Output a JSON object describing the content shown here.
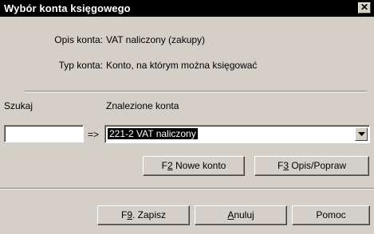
{
  "window": {
    "title": "Wybór konta księgowego",
    "close_glyph": "✕"
  },
  "info": {
    "opis_label": "Opis konta:",
    "opis_value": "VAT naliczony (zakupy)",
    "typ_label": "Typ konta:",
    "typ_value": "Konto, na którym można księgować"
  },
  "search": {
    "label": "Szukaj",
    "value": "",
    "arrow": "=>"
  },
  "found": {
    "label": "Znalezione konta",
    "selected": "221-2 VAT naliczony"
  },
  "buttons": {
    "new_account": {
      "pre": "F",
      "key": "2",
      "post": " Nowe konto"
    },
    "edit": {
      "pre": "F",
      "key": "3",
      "post": " Opis/Popraw"
    },
    "save": {
      "pre": "F",
      "key": "9",
      "post": ". Zapisz"
    },
    "cancel": {
      "pre": "",
      "key": "A",
      "post": "nuluj"
    },
    "help": {
      "pre": "",
      "key": "",
      "post": "Pomoc"
    }
  }
}
